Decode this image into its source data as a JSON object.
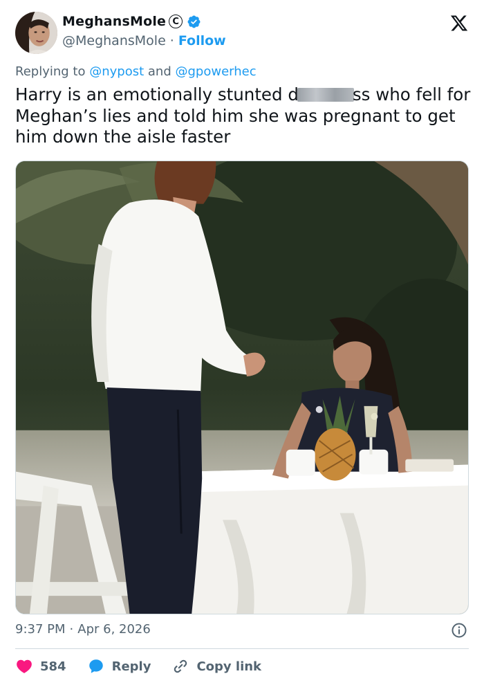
{
  "author": {
    "display_name": "MeghansMole",
    "badge_letter": "C",
    "handle": "@MeghansMole",
    "separator": "·",
    "follow_label": "Follow"
  },
  "reply_context": {
    "prefix": "Replying to",
    "mention_1": "@nypost",
    "conjunction": "and",
    "mention_2": "@gpowerhec"
  },
  "tweet": {
    "text_part_1": "Harry is an emotionally stunted d",
    "text_part_2": "ss who fell for Meghan’s lies and told him she was pregnant to get him down the aisle faster"
  },
  "timestamp": {
    "time": "9:37 PM",
    "separator": "·",
    "date": "Apr 6, 2026"
  },
  "actions": {
    "like_count": "584",
    "reply_label": "Reply",
    "copy_link_label": "Copy link"
  },
  "colors": {
    "accent": "#1d9bf0",
    "like": "#f91880",
    "text_primary": "#0f1419",
    "text_secondary": "#536471"
  },
  "icons": [
    "x-logo-icon",
    "verified-icon",
    "info-icon",
    "heart-icon",
    "reply-icon",
    "link-icon"
  ]
}
